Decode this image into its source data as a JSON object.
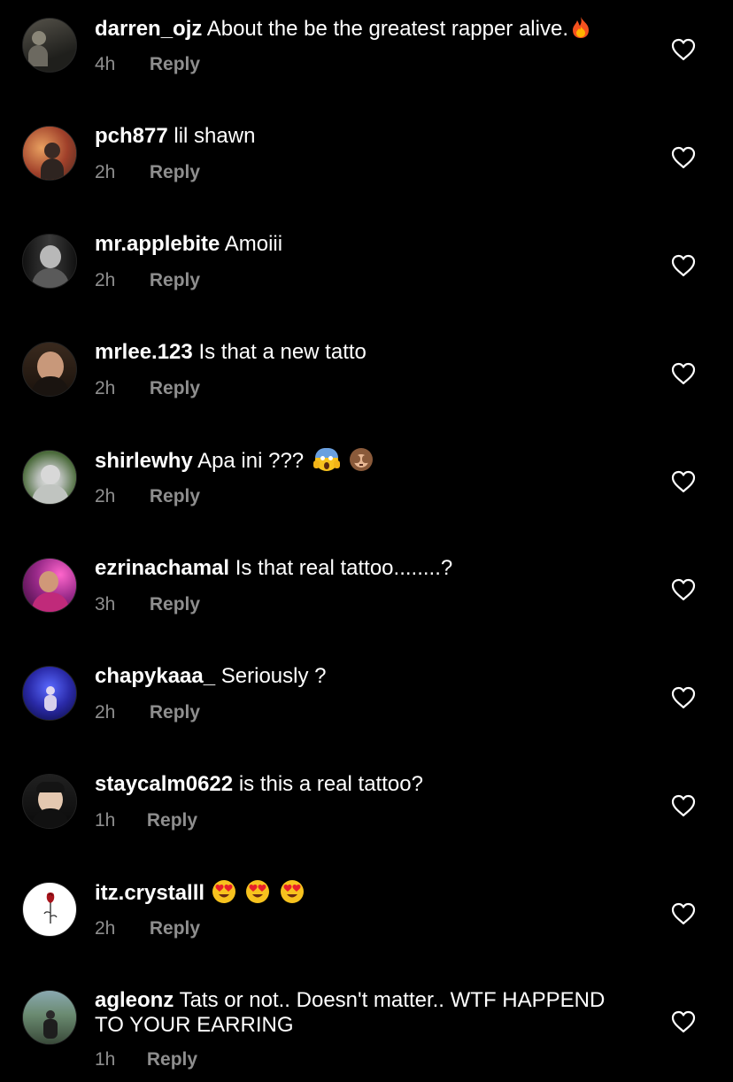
{
  "comments": [
    {
      "user": "darren_ojz",
      "text": "About the be the greatest rapper alive.",
      "emojis": [
        "fire-emoji"
      ],
      "time": "4h",
      "reply": "Reply"
    },
    {
      "user": "pch877",
      "text": "lil shawn",
      "emojis": [],
      "time": "2h",
      "reply": "Reply"
    },
    {
      "user": "mr.applebite",
      "text": "Amoiii",
      "emojis": [],
      "time": "2h",
      "reply": "Reply"
    },
    {
      "user": "mrlee.123",
      "text": "Is that a new tatto",
      "emojis": [],
      "time": "2h",
      "reply": "Reply"
    },
    {
      "user": "shirlewhy",
      "text": "Apa ini ???",
      "emojis": [
        "screaming-face-emoji",
        "see-no-evil-monkey-emoji"
      ],
      "time": "2h",
      "reply": "Reply"
    },
    {
      "user": "ezrinachamal",
      "text": "Is that real tattoo........?",
      "emojis": [],
      "time": "3h",
      "reply": "Reply"
    },
    {
      "user": "chapykaaa_",
      "text": "Seriously ?",
      "emojis": [],
      "time": "2h",
      "reply": "Reply"
    },
    {
      "user": "staycalm0622",
      "text": "is this a real tattoo?",
      "emojis": [],
      "time": "1h",
      "reply": "Reply"
    },
    {
      "user": "itz.crystalll",
      "text": "",
      "emojis": [
        "heart-eyes-emoji",
        "heart-eyes-emoji",
        "heart-eyes-emoji"
      ],
      "time": "2h",
      "reply": "Reply"
    },
    {
      "user": "agleonz",
      "text": "Tats or not.. Doesn't matter.. WTF HAPPEND TO YOUR EARRING",
      "emojis": [],
      "time": "1h",
      "reply": "Reply"
    }
  ],
  "icons": {
    "like": "heart-outline-icon"
  },
  "colors": {
    "background": "#000000",
    "text": "#ffffff",
    "secondary": "#8e8e8e"
  }
}
